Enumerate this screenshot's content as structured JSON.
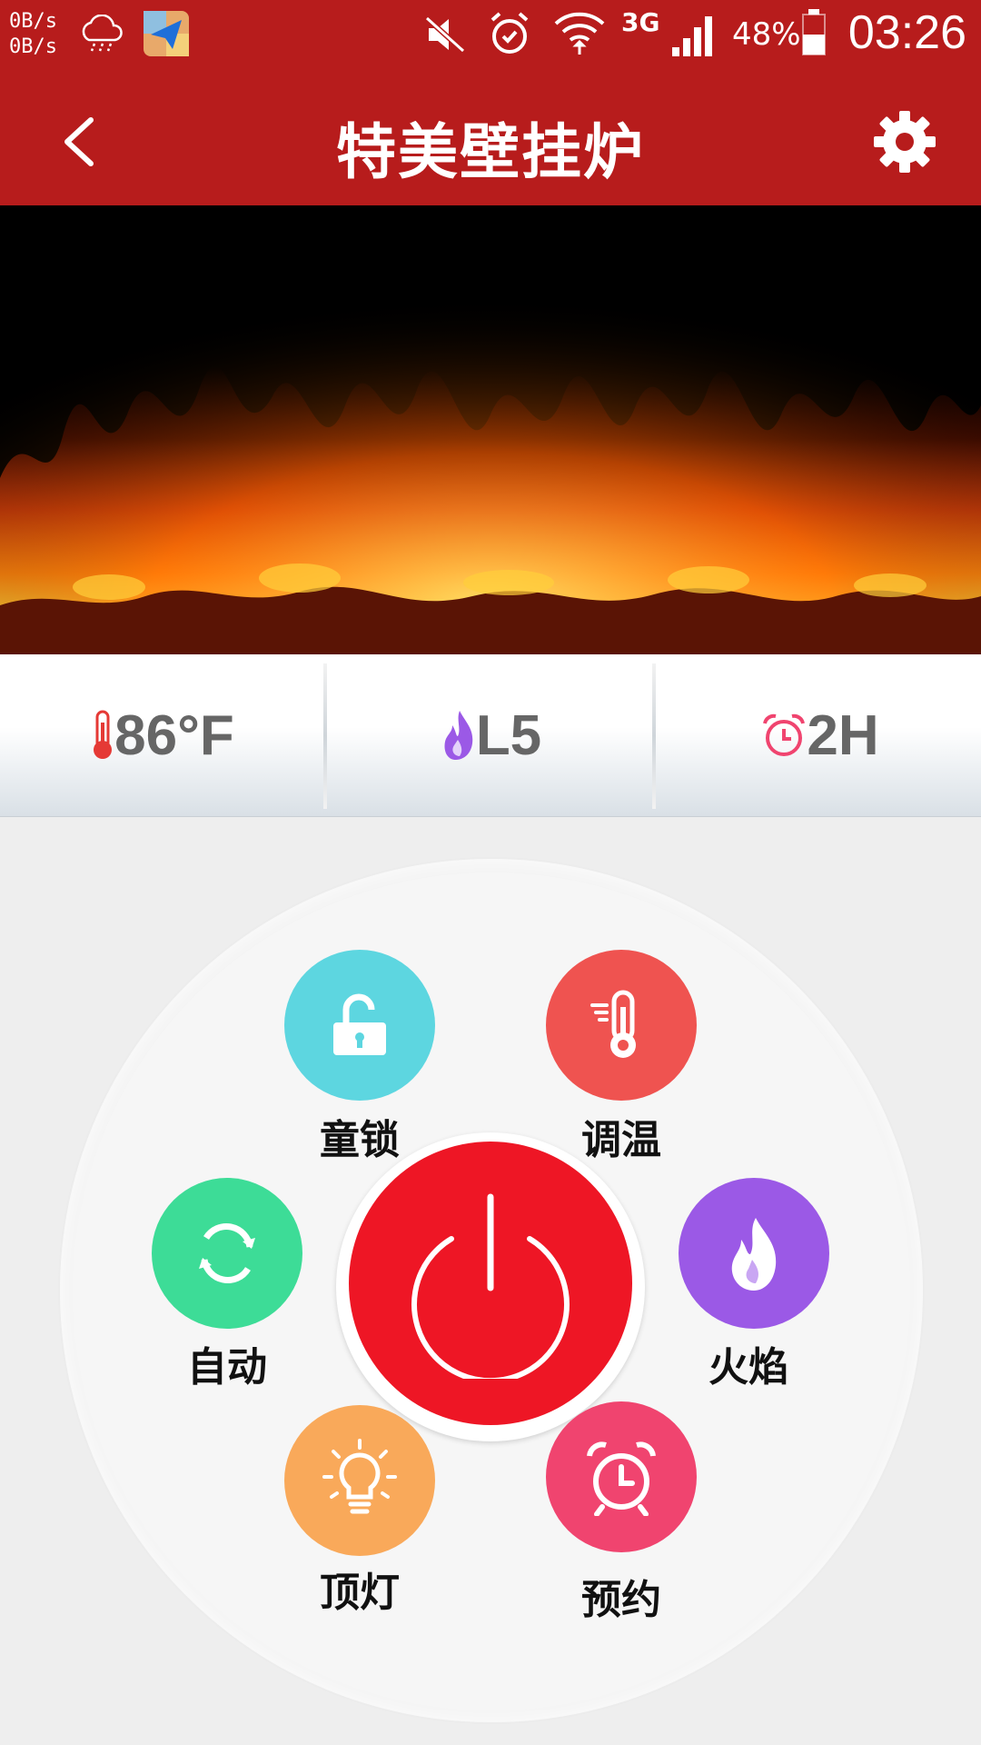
{
  "status_bar": {
    "net_speed_up": "0B/s",
    "net_speed_down": "0B/s",
    "network_type": "3G",
    "battery_percent": "48%",
    "time": "03:26"
  },
  "app_bar": {
    "title": "特美壁挂炉"
  },
  "status_strip": {
    "temperature": "86°F",
    "flame_level": "L5",
    "timer": "2H"
  },
  "controls": {
    "child_lock_label": "童锁",
    "temp_adjust_label": "调温",
    "auto_label": "自动",
    "flame_label": "火焰",
    "top_light_label": "顶灯",
    "schedule_label": "预约"
  },
  "colors": {
    "header_red": "#b71c1c",
    "power_red": "#ee1625",
    "child_lock": "#5dd6e0",
    "temp_adjust": "#ef5350",
    "auto": "#3ddc97",
    "flame": "#9b59e6",
    "top_light": "#f9a95a",
    "schedule": "#f0446f"
  }
}
